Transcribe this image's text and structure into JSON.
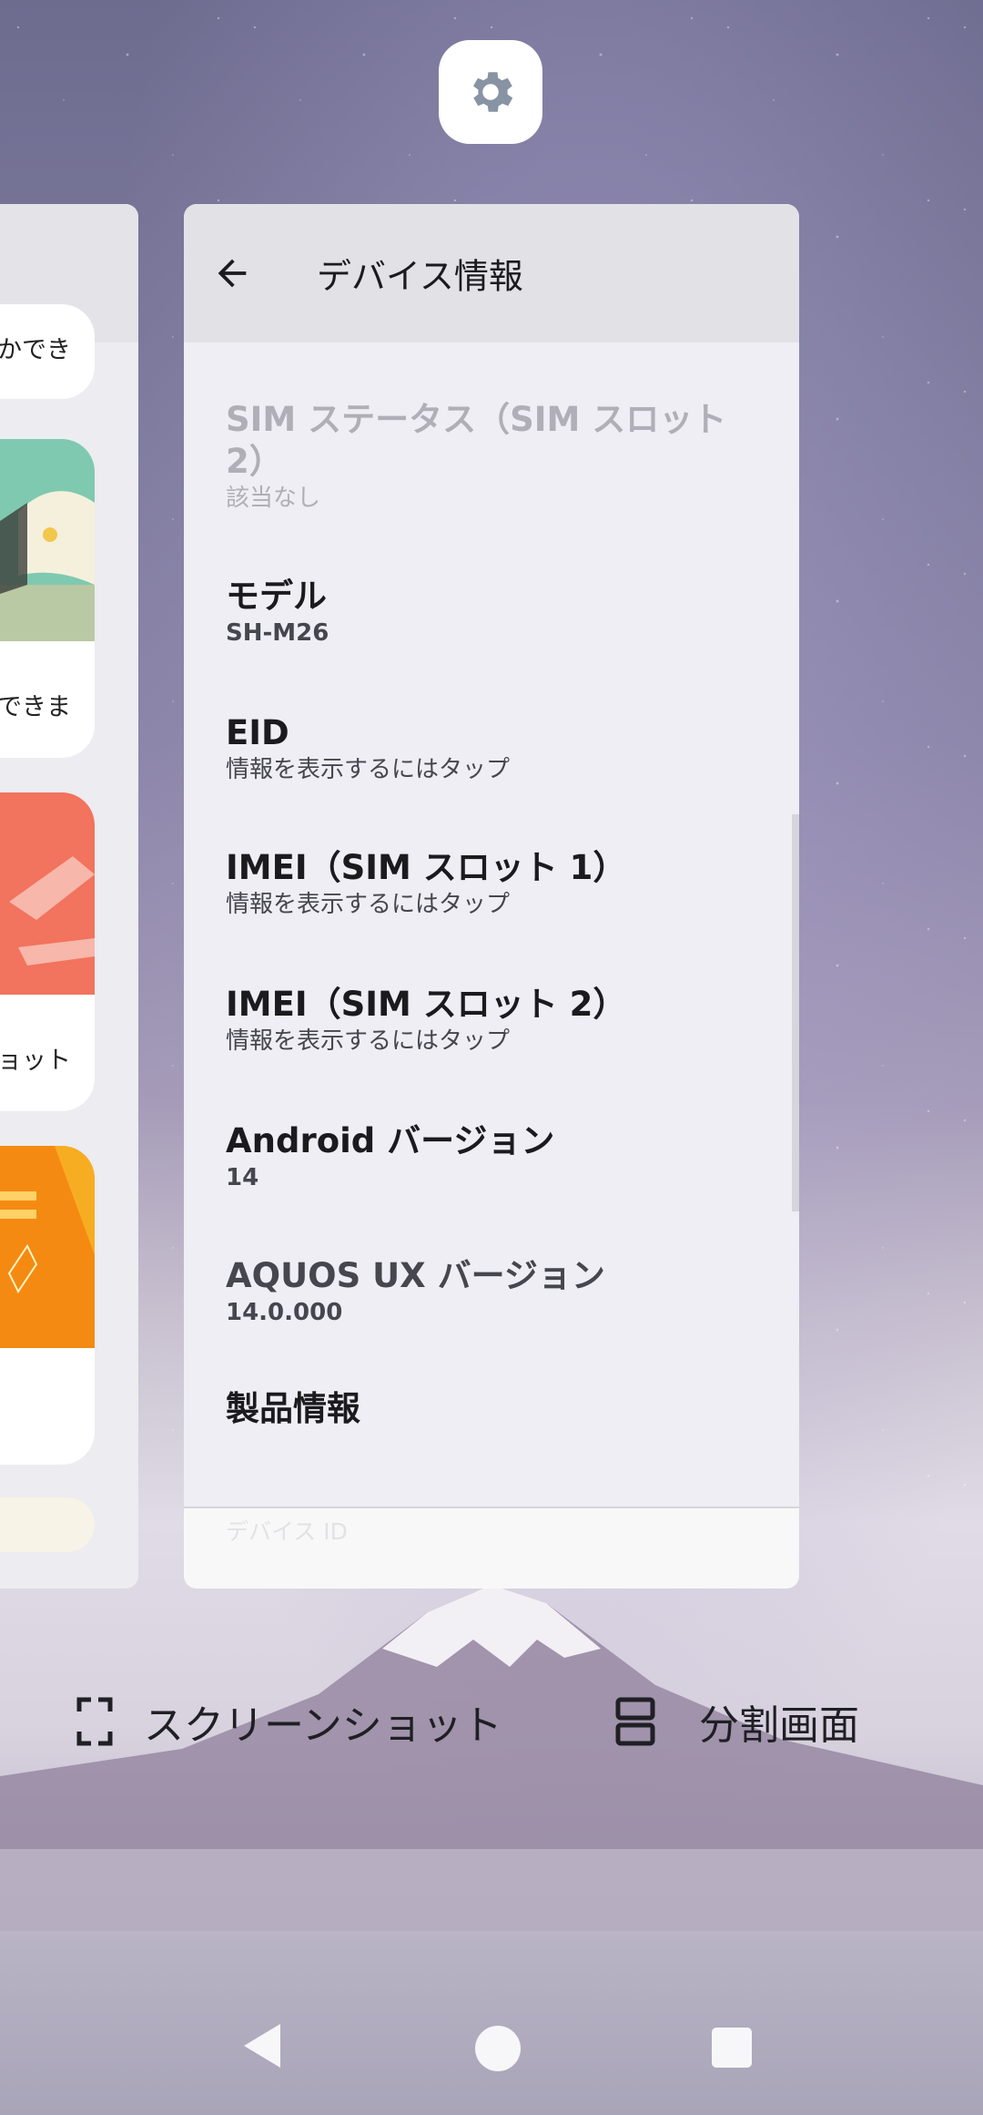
{
  "app": {
    "icon": "settings-gear-icon"
  },
  "left_card": {
    "tiles": [
      {
        "text": "かでき"
      },
      {
        "text": "できま"
      },
      {
        "text": "ョット"
      }
    ]
  },
  "main_card": {
    "header": {
      "back_icon": "back-arrow-icon",
      "title": "デバイス情報"
    },
    "rows": [
      {
        "title": "SIM ステータス（SIM スロット 2）",
        "subtitle": "該当なし",
        "disabled": true
      },
      {
        "title": "モデル",
        "subtitle": "SH-M26"
      },
      {
        "title": "EID",
        "subtitle": "情報を表示するにはタップ"
      },
      {
        "title": "IMEI（SIM スロット 1）",
        "subtitle": "情報を表示するにはタップ"
      },
      {
        "title": "IMEI（SIM スロット 2）",
        "subtitle": "情報を表示するにはタップ"
      },
      {
        "title": "Android バージョン",
        "subtitle": "14"
      },
      {
        "title": "AQUOS UX バージョン",
        "subtitle": "14.0.000"
      },
      {
        "title": "製品情報",
        "subtitle": ""
      }
    ],
    "footer_text": "デバイス ID"
  },
  "actions": {
    "screenshot": {
      "icon": "screenshot-icon",
      "label": "スクリーンショット"
    },
    "split": {
      "icon": "split-screen-icon",
      "label": "分割画面"
    }
  },
  "nav": {
    "back_icon": "nav-back-icon",
    "home_icon": "nav-home-icon",
    "recents_icon": "nav-recents-icon"
  },
  "colors": {
    "card_bg": "#efeef4",
    "header_bg": "#e2e2e6",
    "text": "#1b1b1f",
    "disabled": "#b0afb7"
  }
}
